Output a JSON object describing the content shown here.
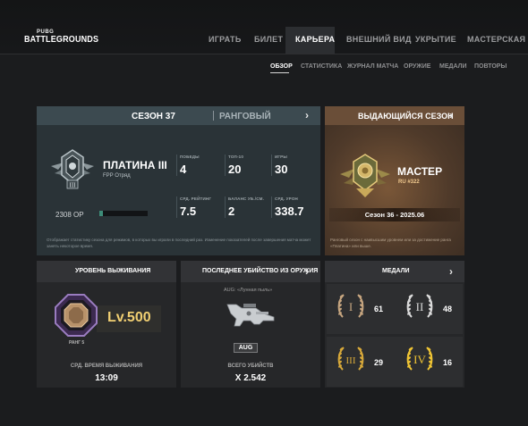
{
  "logo": {
    "small": "PUBG",
    "big": "BATTLEGROUNDS"
  },
  "nav": {
    "items": [
      "ИГРАТЬ",
      "БИЛЕТ",
      "КАРЬЕРА",
      "ВНЕШНИЙ ВИД",
      "УКРЫТИЕ",
      "МАСТЕРСКАЯ"
    ],
    "active": "КАРЬЕРА"
  },
  "subnav": {
    "items": [
      "ОБЗОР",
      "СТАТИСТИКА",
      "ЖУРНАЛ МАТЧА",
      "ОРУЖИЕ",
      "МЕДАЛИ",
      "ПОВТОРЫ"
    ],
    "active": "ОБЗОР"
  },
  "season": {
    "title": "СЕЗОН 37",
    "mode": "РАНГОВЫЙ",
    "rank_name": "ПЛАТИНА III",
    "rank_mode": "FPP Отряд",
    "rp": "2308 ОР",
    "rp_progress": 0.08,
    "stats": [
      {
        "label": "ПОБЕДЫ",
        "value": "4"
      },
      {
        "label": "ТОП-10",
        "value": "20"
      },
      {
        "label": "ИГРЫ",
        "value": "30"
      },
      {
        "label": "СРД. РЕЙТИНГ",
        "value": "7.5"
      },
      {
        "label": "БАЛАНС УБ./СМ.",
        "value": "2"
      },
      {
        "label": "СРД. УРОН",
        "value": "338.7"
      }
    ],
    "note": "Отображает статистику сезона для режимов, в которых вы играли в последний раз. Изменение показателей после завершения матча может занять некоторое время."
  },
  "best_season": {
    "title": "ВЫДАЮЩИЙСЯ СЕЗОН",
    "rank_name": "МАСТЕР",
    "rank_sub": "RU #322",
    "season_label": "Сезон 36 - 2025.06",
    "note": "Ранговый сезон с наивысшим уровнем или за достижение ранга «Платина» или выше."
  },
  "survival": {
    "title": "УРОВЕНЬ ВЫЖИВАНИЯ",
    "level": "Lv.500",
    "rank": "РАНГ 5",
    "time_label": "СРД. ВРЕМЯ ВЫЖИВАНИЯ",
    "time_value": "13:09"
  },
  "last_kill": {
    "title": "ПОСЛЕДНЕЕ УБИЙСТВО ИЗ ОРУЖИЯ",
    "weapon_skin": "AUG: «Лунная пыль»",
    "weapon_tag": "AUG",
    "kills_label": "ВСЕГО УБИЙСТВ",
    "kills_value": "X 2.542"
  },
  "medals": {
    "title": "МЕДАЛИ",
    "items": [
      {
        "numeral": "I",
        "count": "61",
        "color": "#c7a680"
      },
      {
        "numeral": "II",
        "count": "48",
        "color": "#dcdcdc"
      },
      {
        "numeral": "III",
        "count": "29",
        "color": "#d8a93a"
      },
      {
        "numeral": "IV",
        "count": "16",
        "color": "#f0c534"
      }
    ]
  },
  "colors": {
    "accent_teal": "#3d8c78",
    "gold": "#f1cf72"
  }
}
